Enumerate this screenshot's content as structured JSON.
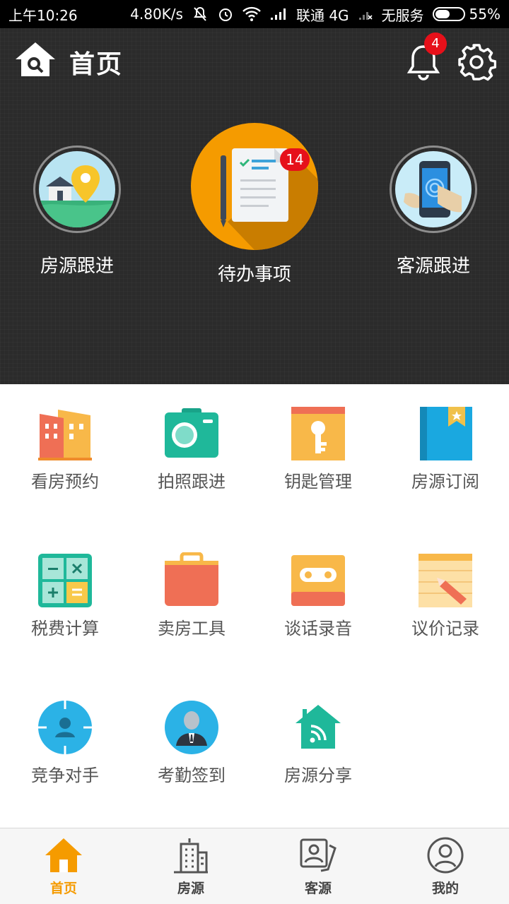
{
  "status_bar": {
    "time": "上午10:26",
    "net_speed": "4.80K/s",
    "carrier": "联通",
    "network_type": "4G",
    "second_sim": "无服务",
    "battery_percent": "55%",
    "battery_level": 0.55
  },
  "header": {
    "title": "首页",
    "notification_count": "4"
  },
  "features": {
    "left": {
      "label": "房源跟进",
      "icon": "property-location-icon"
    },
    "center": {
      "label": "待办事项",
      "badge": "14",
      "icon": "todo-document-icon"
    },
    "right": {
      "label": "客源跟进",
      "icon": "phone-touch-icon"
    }
  },
  "tools": [
    {
      "label": "看房预约",
      "icon": "buildings-icon"
    },
    {
      "label": "拍照跟进",
      "icon": "camera-icon"
    },
    {
      "label": "钥匙管理",
      "icon": "key-icon"
    },
    {
      "label": "房源订阅",
      "icon": "bookmark-book-icon"
    },
    {
      "label": "税费计算",
      "icon": "calculator-icon"
    },
    {
      "label": "卖房工具",
      "icon": "briefcase-icon"
    },
    {
      "label": "谈话录音",
      "icon": "cassette-icon"
    },
    {
      "label": "议价记录",
      "icon": "notepad-pencil-icon"
    },
    {
      "label": "竞争对手",
      "icon": "target-person-icon"
    },
    {
      "label": "考勤签到",
      "icon": "businessman-icon"
    },
    {
      "label": "房源分享",
      "icon": "house-share-icon"
    }
  ],
  "bottom_nav": {
    "items": [
      {
        "label": "首页",
        "icon": "home-icon",
        "active": true
      },
      {
        "label": "房源",
        "icon": "building-icon",
        "active": false
      },
      {
        "label": "客源",
        "icon": "contact-card-icon",
        "active": false
      },
      {
        "label": "我的",
        "icon": "user-circle-icon",
        "active": false
      }
    ]
  },
  "colors": {
    "accent": "#f59b00",
    "badge": "#e6101a",
    "header_bg": "#2b2b2b"
  }
}
